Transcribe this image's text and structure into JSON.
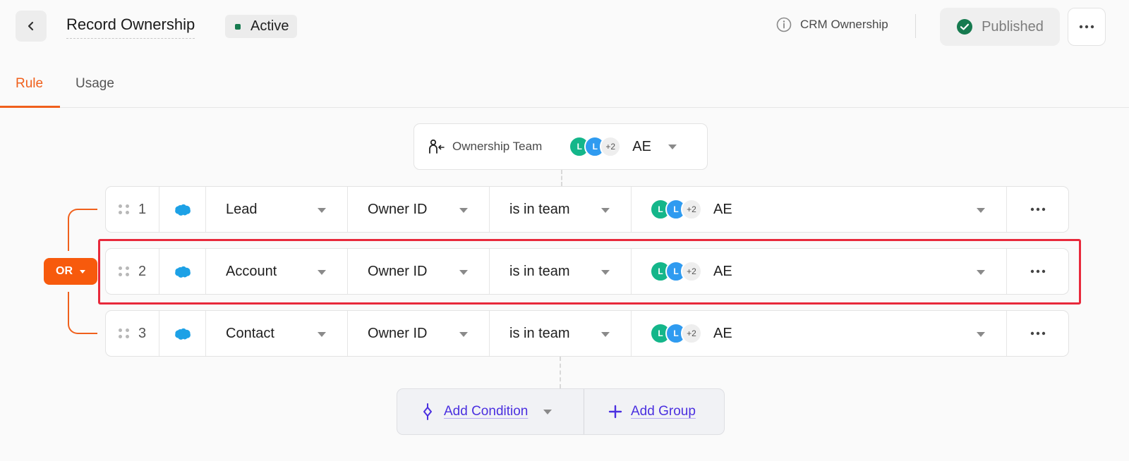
{
  "header": {
    "title": "Record Ownership",
    "status": "Active",
    "status_color": "#167a4f",
    "crm_link": "CRM Ownership",
    "published_label": "Published",
    "published_color": "#167a4f"
  },
  "tabs": [
    {
      "label": "Rule",
      "active": true
    },
    {
      "label": "Usage",
      "active": false
    }
  ],
  "accent_color": "#f0601c",
  "team_card": {
    "label": "Ownership Team",
    "avatars": [
      "L",
      "L"
    ],
    "more_count": "+2",
    "value": "AE"
  },
  "group_operator": "OR",
  "rows": [
    {
      "num": "1",
      "object": "Lead",
      "field": "Owner ID",
      "operator": "is in team",
      "avatars": [
        "L",
        "L"
      ],
      "more": "+2",
      "value": "AE"
    },
    {
      "num": "2",
      "object": "Account",
      "field": "Owner ID",
      "operator": "is in team",
      "avatars": [
        "L",
        "L"
      ],
      "more": "+2",
      "value": "AE"
    },
    {
      "num": "3",
      "object": "Contact",
      "field": "Owner ID",
      "operator": "is in team",
      "avatars": [
        "L",
        "L"
      ],
      "more": "+2",
      "value": "AE"
    }
  ],
  "actions": {
    "add_condition": "Add Condition",
    "add_group": "Add Group"
  }
}
